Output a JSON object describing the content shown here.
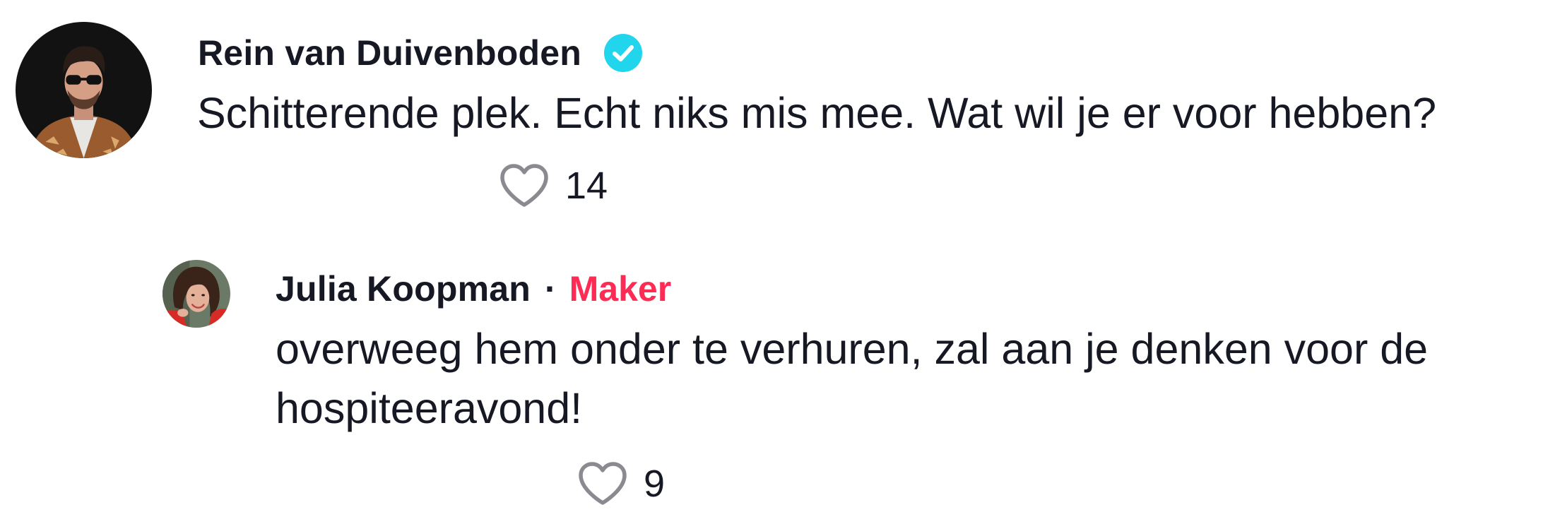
{
  "comments": [
    {
      "author": "Rein van Duivenboden",
      "verified": true,
      "text": "Schitterende plek. Echt niks mis mee. Wat wil je er voor hebben?",
      "likes": "14"
    }
  ],
  "reply": {
    "author": "Julia Koopman",
    "separator": "·",
    "badge": "Maker",
    "text_line1": "overweeg hem onder te verhuren, zal aan je denken voor de",
    "text_line2": "hospiteeravond!",
    "likes": "9"
  },
  "colors": {
    "text": "#161823",
    "maker_badge": "#fe2c55",
    "verified_badge": "#20d5ec",
    "like_icon": "#8a8b91",
    "background": "#ffffff"
  },
  "icons": {
    "verified": "verified-badge-icon",
    "like": "heart-outline-icon"
  }
}
